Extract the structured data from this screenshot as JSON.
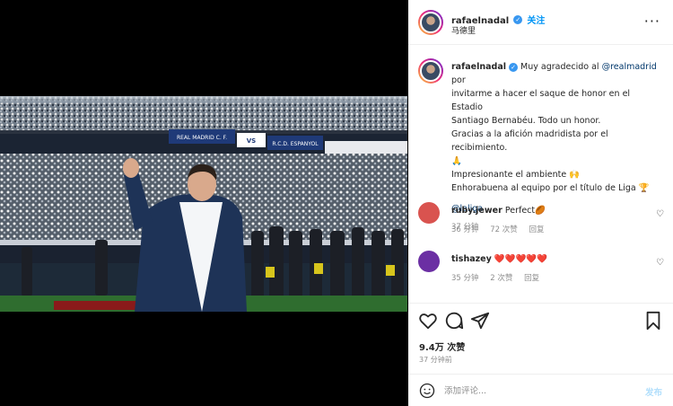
{
  "post": {
    "username": "rafaelnadal",
    "follow_label": "关注",
    "location": "马德里",
    "more_label": "···"
  },
  "photo": {
    "banner_left": "REAL MADRID C. F.",
    "banner_vs": "VS",
    "banner_right": "R.C.D. ESPANYOL"
  },
  "caption": {
    "username": "rafaelnadal",
    "lines": [
      "Muy agradecido al ",
      "invitarme a hacer el saque de honor en el Estadio",
      "Santiago Bernabéu. Todo un honor.",
      "Gracias a la afición madridista por el recibimiento.",
      "🙏",
      "Impresionante el ambiente 🙌",
      "Enhorabuena al equipo por el título de Liga 🏆"
    ],
    "mention_realmadrid": "@realmadrid",
    "por": " por",
    "mention_laliga": "@laliga",
    "time": "37 分钟"
  },
  "comments": [
    {
      "username": "ruby.jewer",
      "text": "Perfect🏉",
      "time": "36 分钟",
      "likes": "72 次赞",
      "reply": "回复",
      "avatar_color": "#d9534f"
    },
    {
      "username": "tishazey",
      "text": "❤️❤️❤️❤️❤️",
      "time": "35 分钟",
      "likes": "2 次赞",
      "reply": "回复",
      "avatar_color": "#6b2fa3"
    }
  ],
  "actions": {
    "likes_count": "9.4万 次赞",
    "posted_time": "37 分钟前"
  },
  "comment_box": {
    "placeholder": "添加评论...",
    "post_label": "发布"
  },
  "colors": {
    "accent": "#0095f6",
    "verified": "#3897f0",
    "muted": "#8e8e8e"
  }
}
